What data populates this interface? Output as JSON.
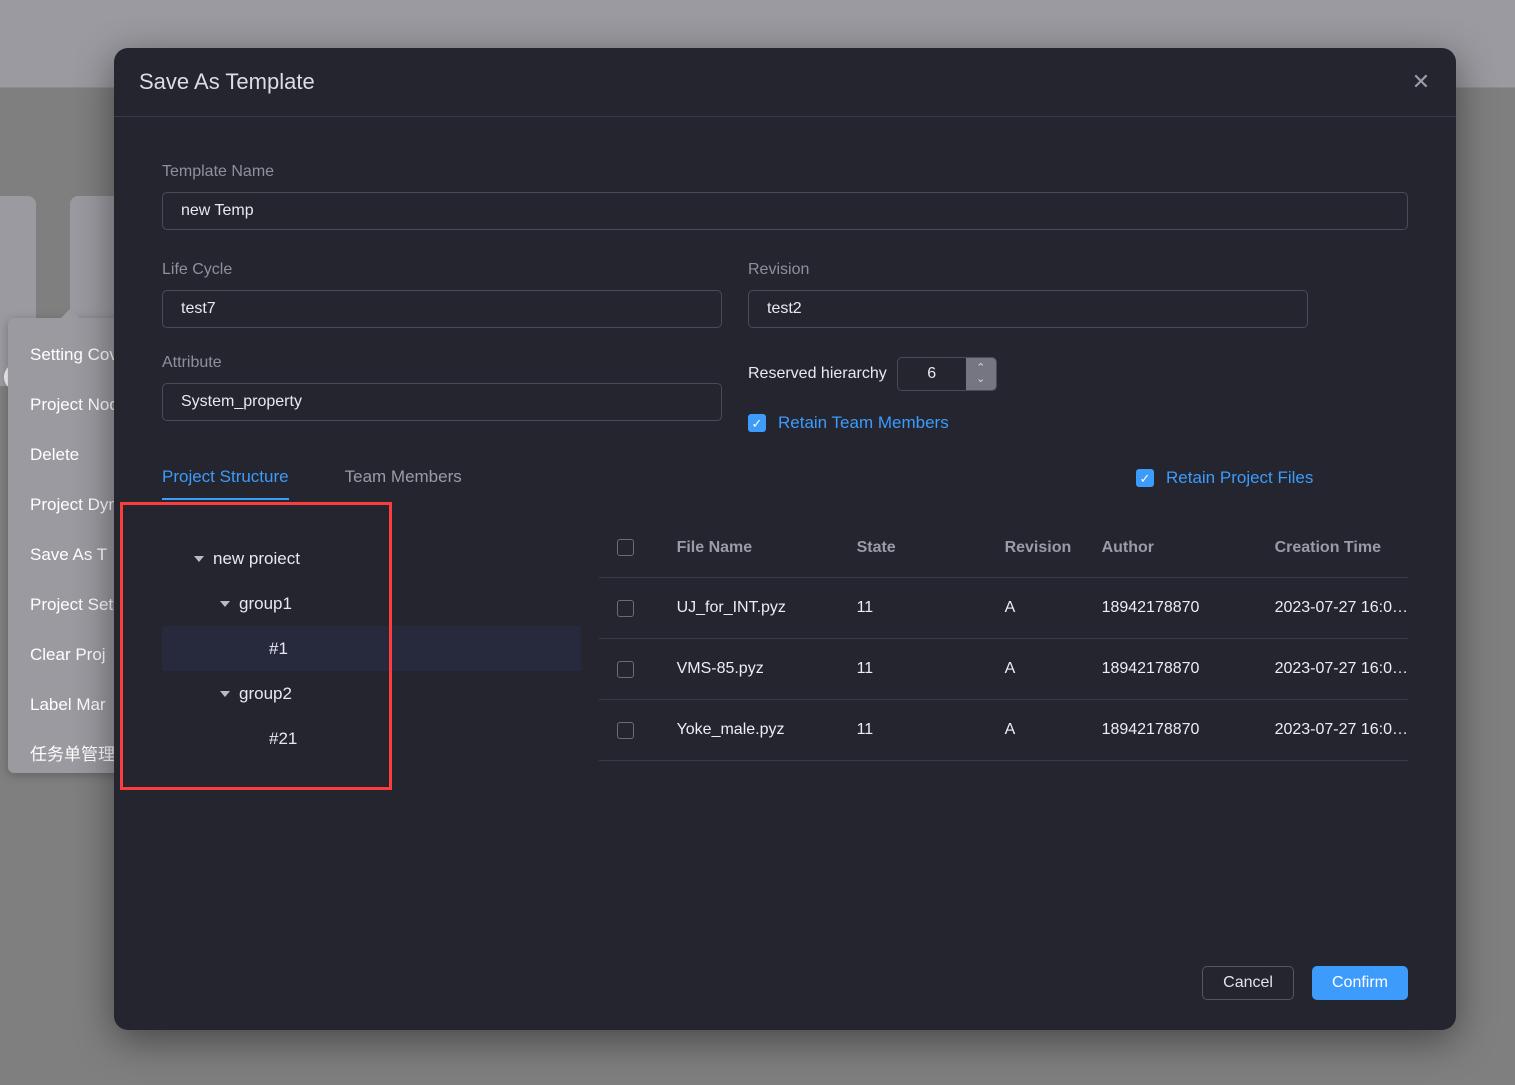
{
  "background": {
    "context_menu": {
      "items": [
        {
          "label": "Setting Cov"
        },
        {
          "label": "Project Nod"
        },
        {
          "label": "Delete"
        },
        {
          "label": "Project Dyn"
        },
        {
          "label": "Save As T"
        },
        {
          "label": "Project Set"
        },
        {
          "label": "Clear Proj"
        },
        {
          "label": "Label Mar"
        },
        {
          "label": "任务单管理"
        }
      ]
    },
    "dots_icon": "•••"
  },
  "modal": {
    "title": "Save As Template",
    "close_icon": "✕",
    "fields": {
      "template_name_label": "Template Name",
      "template_name_value": "new Temp",
      "life_cycle_label": "Life Cycle",
      "life_cycle_value": "test7",
      "revision_label": "Revision",
      "revision_value": "test2",
      "attribute_label": "Attribute",
      "attribute_value": "System_property",
      "reserved_hierarchy_label": "Reserved hierarchy",
      "reserved_hierarchy_value": "6",
      "spinner_up_icon": "⌃",
      "spinner_down_icon": "⌄"
    },
    "checkboxes": {
      "retain_team_members": "Retain Team Members",
      "retain_project_files": "Retain Project Files",
      "check_glyph": "✓"
    },
    "tabs": [
      {
        "label": "Project Structure",
        "active": true
      },
      {
        "label": "Team Members",
        "active": false
      }
    ],
    "tree": [
      {
        "label": "new proiect",
        "level": 0,
        "expanded": true,
        "selected": false
      },
      {
        "label": "group1",
        "level": 1,
        "expanded": true,
        "selected": false
      },
      {
        "label": "#1",
        "level": 2,
        "expanded": false,
        "selected": true
      },
      {
        "label": "group2",
        "level": 1,
        "expanded": true,
        "selected": false
      },
      {
        "label": "#21",
        "level": 2,
        "expanded": false,
        "selected": false
      }
    ],
    "table": {
      "columns": [
        "File Name",
        "State",
        "Revision",
        "Author",
        "Creation Time"
      ],
      "rows": [
        {
          "file_name": "UJ_for_INT.pyz",
          "state": "11",
          "revision": "A",
          "author": "18942178870",
          "creation_time": "2023-07-27 16:0…"
        },
        {
          "file_name": "VMS-85.pyz",
          "state": "11",
          "revision": "A",
          "author": "18942178870",
          "creation_time": "2023-07-27 16:0…"
        },
        {
          "file_name": "Yoke_male.pyz",
          "state": "11",
          "revision": "A",
          "author": "18942178870",
          "creation_time": "2023-07-27 16:0…"
        }
      ]
    },
    "footer": {
      "cancel_label": "Cancel",
      "confirm_label": "Confirm"
    }
  },
  "colors": {
    "accent": "#3d9bfb",
    "modal_bg": "#24252f",
    "highlight_box": "#fc3d3d",
    "selected_row": "#262a3c"
  }
}
